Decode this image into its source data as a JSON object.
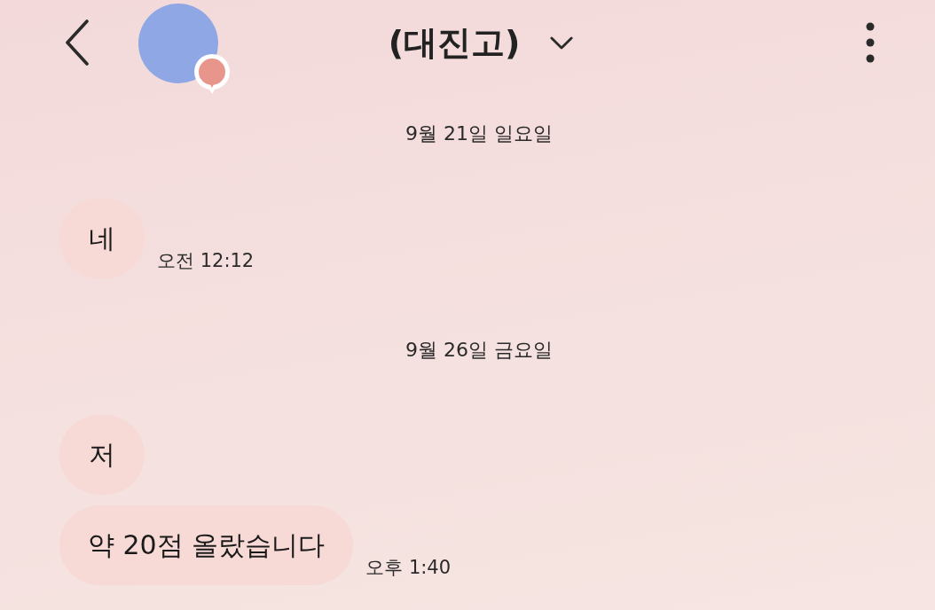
{
  "header": {
    "title": "(대진고)"
  },
  "days": [
    {
      "date": "9월 21일 일요일",
      "messages": [
        {
          "text": "네",
          "time": "오전 12:12"
        }
      ]
    },
    {
      "date": "9월 26일 금요일",
      "messages": [
        {
          "text": "저"
        },
        {
          "text": "약 20점 올랐습니다",
          "time": "오후 1:40"
        }
      ]
    }
  ]
}
